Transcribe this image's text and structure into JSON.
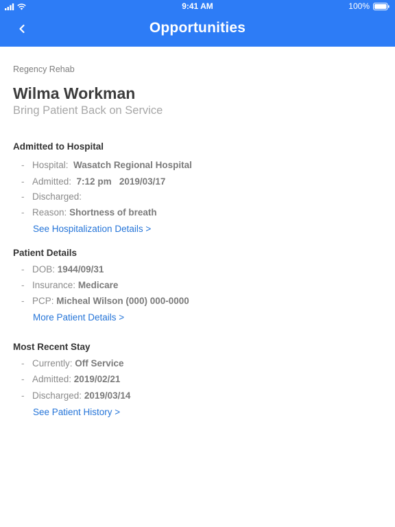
{
  "status_bar": {
    "time": "9:41 AM",
    "battery": "100%"
  },
  "nav": {
    "title": "Opportunities",
    "back_icon": "chevron-left-icon"
  },
  "facility": "Regency Rehab",
  "patient": {
    "name": "Wilma Workman",
    "subtitle": "Bring Patient Back on Service"
  },
  "sections": {
    "admitted": {
      "title": "Admitted to Hospital",
      "hospital_label": "Hospital:",
      "hospital_value": "Wasatch Regional Hospital",
      "admitted_label": "Admitted:",
      "admitted_time": "7:12 pm",
      "admitted_date": "2019/03/17",
      "discharged_label": "Discharged:",
      "reason_label": "Reason:",
      "reason_value": "Shortness of breath",
      "link": "See Hospitalization Details >"
    },
    "patient_details": {
      "title": "Patient Details",
      "dob_label": "DOB:",
      "dob_value": "1944/09/31",
      "insurance_label": "Insurance:",
      "insurance_value": "Medicare",
      "pcp_label": "PCP:",
      "pcp_value": "Micheal Wilson (000) 000-0000",
      "link": "More Patient Details >"
    },
    "recent_stay": {
      "title": "Most Recent Stay",
      "currently_label": "Currently:",
      "currently_value": "Off Service",
      "admitted_label": "Admitted:",
      "admitted_value": "2019/02/21",
      "discharged_label": "Discharged:",
      "discharged_value": "2019/03/14",
      "link": "See Patient History >"
    }
  },
  "colors": {
    "header_bg": "#2d7cf6",
    "link": "#2474d8"
  }
}
